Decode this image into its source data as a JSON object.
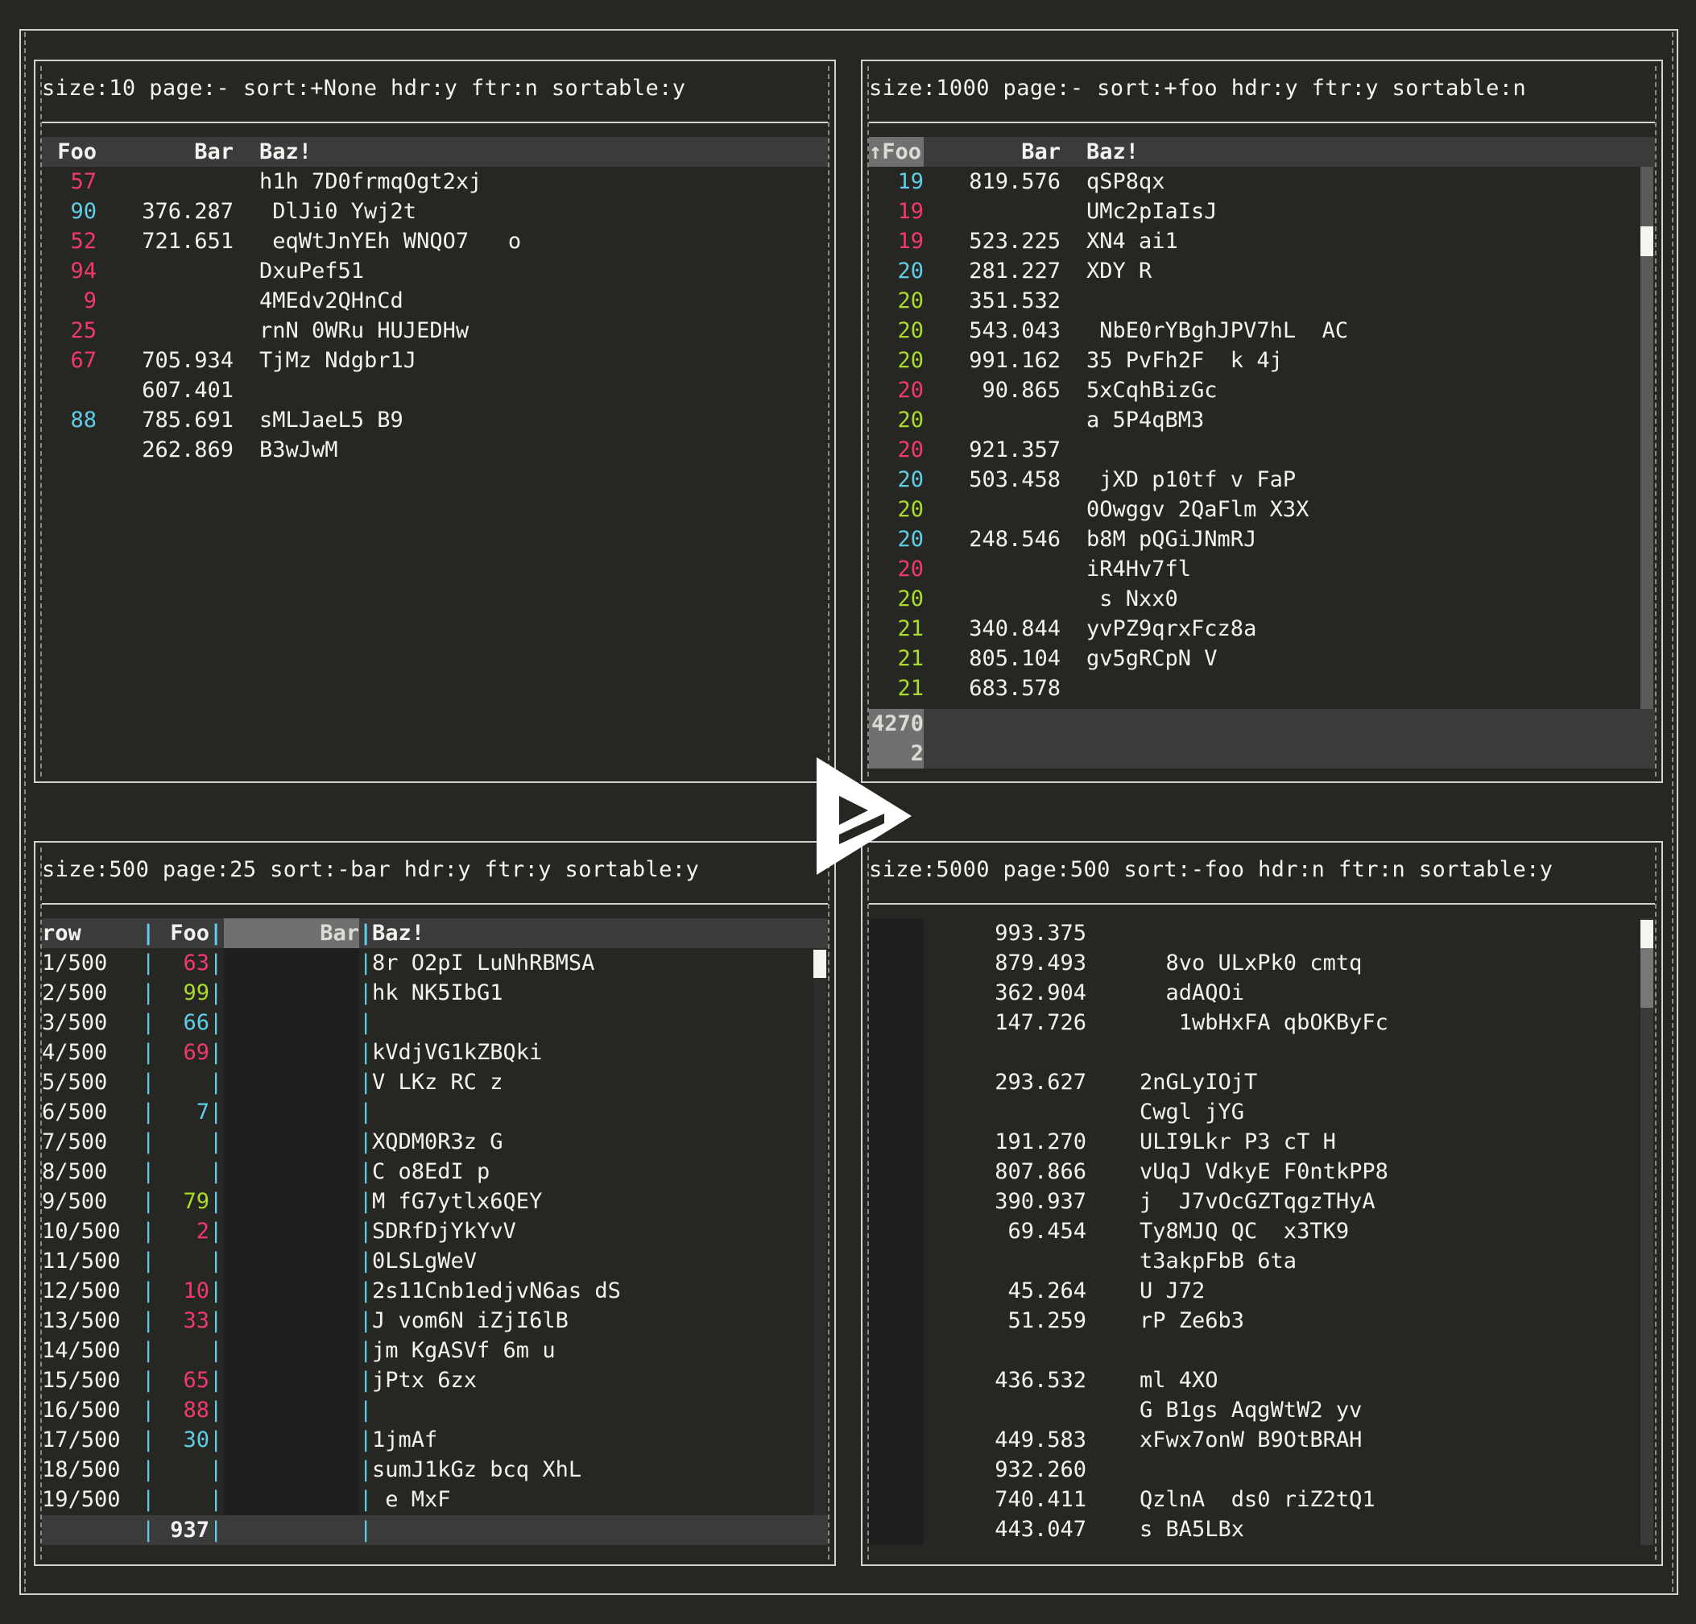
{
  "panels": {
    "p1": {
      "title": "size:10 page:- sort:+None hdr:y ftr:n sortable:y",
      "headers": {
        "foo": "Foo",
        "bar": "Bar",
        "baz": "Baz!"
      },
      "rows": [
        {
          "foo": "57",
          "foo_color": "red",
          "bar": "",
          "baz": "h1h 7D0frmqOgt2xj"
        },
        {
          "foo": "90",
          "foo_color": "cyan",
          "bar": "376.287",
          "baz": " DlJi0 Ywj2t"
        },
        {
          "foo": "52",
          "foo_color": "red",
          "bar": "721.651",
          "baz": " eqWtJnYEh WNQO7   o"
        },
        {
          "foo": "94",
          "foo_color": "red",
          "bar": "",
          "baz": "DxuPef51"
        },
        {
          "foo": "9",
          "foo_color": "red",
          "bar": "",
          "baz": "4MEdv2QHnCd"
        },
        {
          "foo": "25",
          "foo_color": "red",
          "bar": "",
          "baz": "rnN 0WRu HUJEDHw"
        },
        {
          "foo": "67",
          "foo_color": "red",
          "bar": "705.934",
          "baz": "TjMz Ndgbr1J"
        },
        {
          "foo": "",
          "foo_color": "red",
          "bar": "607.401",
          "baz": ""
        },
        {
          "foo": "88",
          "foo_color": "cyan",
          "bar": "785.691",
          "baz": "sMLJaeL5 B9"
        },
        {
          "foo": "",
          "foo_color": "red",
          "bar": "262.869",
          "baz": "B3wJwM"
        }
      ]
    },
    "p2": {
      "title": "size:1000 page:- sort:+foo hdr:y ftr:y sortable:n",
      "headers": {
        "foo": "↑Foo",
        "bar": "Bar",
        "baz": "Baz!"
      },
      "rows": [
        {
          "foo": "19",
          "foo_color": "cyan",
          "bar": "819.576",
          "baz": "qSP8qx"
        },
        {
          "foo": "19",
          "foo_color": "red",
          "bar": "",
          "baz": "UMc2pIaIsJ"
        },
        {
          "foo": "19",
          "foo_color": "red",
          "bar": "523.225",
          "baz": "XN4 ai1"
        },
        {
          "foo": "20",
          "foo_color": "cyan",
          "bar": "281.227",
          "baz": "XDY R"
        },
        {
          "foo": "20",
          "foo_color": "green",
          "bar": "351.532",
          "baz": ""
        },
        {
          "foo": "20",
          "foo_color": "green",
          "bar": "543.043",
          "baz": " NbE0rYBghJPV7hL  AC"
        },
        {
          "foo": "20",
          "foo_color": "green",
          "bar": "991.162",
          "baz": "35 PvFh2F  k 4j"
        },
        {
          "foo": "20",
          "foo_color": "red",
          "bar": "90.865",
          "baz": "5xCqhBizGc"
        },
        {
          "foo": "20",
          "foo_color": "green",
          "bar": "",
          "baz": "a 5P4qBM3"
        },
        {
          "foo": "20",
          "foo_color": "red",
          "bar": "921.357",
          "baz": ""
        },
        {
          "foo": "20",
          "foo_color": "cyan",
          "bar": "503.458",
          "baz": " jXD p10tf v FaP"
        },
        {
          "foo": "20",
          "foo_color": "green",
          "bar": "",
          "baz": "0Owggv 2QaFlm X3X"
        },
        {
          "foo": "20",
          "foo_color": "cyan",
          "bar": "248.546",
          "baz": "b8M pQGiJNmRJ"
        },
        {
          "foo": "20",
          "foo_color": "red",
          "bar": "",
          "baz": "iR4Hv7fl"
        },
        {
          "foo": "20",
          "foo_color": "green",
          "bar": "",
          "baz": " s Nxx0"
        },
        {
          "foo": "21",
          "foo_color": "green",
          "bar": "340.844",
          "baz": "yvPZ9qrxFcz8a"
        },
        {
          "foo": "21",
          "foo_color": "green",
          "bar": "805.104",
          "baz": "gv5gRCpN V"
        },
        {
          "foo": "21",
          "foo_color": "green",
          "bar": "683.578",
          "baz": ""
        }
      ],
      "footer": {
        "line1": "4270",
        "line2": "2"
      }
    },
    "p3": {
      "title": "size:500 page:25 sort:-bar hdr:y ftr:y sortable:y",
      "headers": {
        "row": "row",
        "foo": "Foo",
        "bar": "Bar",
        "baz": "Baz!"
      },
      "rows": [
        {
          "row": "1/500",
          "foo": "63",
          "foo_color": "red",
          "baz": "8r O2pI LuNhRBMSA"
        },
        {
          "row": "2/500",
          "foo": "99",
          "foo_color": "green",
          "baz": "hk NK5IbG1"
        },
        {
          "row": "3/500",
          "foo": "66",
          "foo_color": "cyan",
          "baz": ""
        },
        {
          "row": "4/500",
          "foo": "69",
          "foo_color": "red",
          "baz": "kVdjVG1kZBQki"
        },
        {
          "row": "5/500",
          "foo": "",
          "foo_color": "red",
          "baz": "V LKz RC z"
        },
        {
          "row": "6/500",
          "foo": "7",
          "foo_color": "cyan",
          "baz": ""
        },
        {
          "row": "7/500",
          "foo": "",
          "foo_color": "red",
          "baz": "XQDM0R3z G"
        },
        {
          "row": "8/500",
          "foo": "",
          "foo_color": "red",
          "baz": "C o8EdI p"
        },
        {
          "row": "9/500",
          "foo": "79",
          "foo_color": "green",
          "baz": "M fG7ytlx6QEY"
        },
        {
          "row": "10/500",
          "foo": "2",
          "foo_color": "red",
          "baz": "SDRfDjYkYvV"
        },
        {
          "row": "11/500",
          "foo": "",
          "foo_color": "red",
          "baz": "0LSLgWeV"
        },
        {
          "row": "12/500",
          "foo": "10",
          "foo_color": "red",
          "baz": "2s11Cnb1edjvN6as dS"
        },
        {
          "row": "13/500",
          "foo": "33",
          "foo_color": "red",
          "baz": "J vom6N iZjI6lB"
        },
        {
          "row": "14/500",
          "foo": "",
          "foo_color": "red",
          "baz": "jm KgASVf 6m u"
        },
        {
          "row": "15/500",
          "foo": "65",
          "foo_color": "red",
          "baz": "jPtx 6zx"
        },
        {
          "row": "16/500",
          "foo": "88",
          "foo_color": "red",
          "baz": ""
        },
        {
          "row": "17/500",
          "foo": "30",
          "foo_color": "cyan",
          "baz": "1jmAf"
        },
        {
          "row": "18/500",
          "foo": "",
          "foo_color": "red",
          "baz": "sumJ1kGz bcq XhL"
        },
        {
          "row": "19/500",
          "foo": "",
          "foo_color": "red",
          "baz": " e MxF"
        }
      ],
      "footer": {
        "foo": "937"
      }
    },
    "p4": {
      "title": "size:5000 page:500 sort:-foo hdr:n ftr:n sortable:y",
      "rows": [
        {
          "bar": "993.375",
          "baz": ""
        },
        {
          "bar": "879.493",
          "baz": "  8vo ULxPk0 cmtq"
        },
        {
          "bar": "362.904",
          "baz": "  adAQOi"
        },
        {
          "bar": "147.726",
          "baz": "   1wbHxFA qbOKByFc"
        },
        {
          "bar": "",
          "baz": ""
        },
        {
          "bar": "293.627",
          "baz": "2nGLyIOjT"
        },
        {
          "bar": "",
          "baz": "Cwgl jYG"
        },
        {
          "bar": "191.270",
          "baz": "ULI9Lkr P3 cT H"
        },
        {
          "bar": "807.866",
          "baz": "vUqJ VdkyE F0ntkPP8"
        },
        {
          "bar": "390.937",
          "baz": "j  J7vOcGZTqgzTHyA"
        },
        {
          "bar": "69.454",
          "baz": "Ty8MJQ QC  x3TK9"
        },
        {
          "bar": "",
          "baz": "t3akpFbB 6ta"
        },
        {
          "bar": "45.264",
          "baz": "U J72"
        },
        {
          "bar": "51.259",
          "baz": "rP Ze6b3"
        },
        {
          "bar": "",
          "baz": ""
        },
        {
          "bar": "436.532",
          "baz": "ml 4XO"
        },
        {
          "bar": "",
          "baz": "G B1gs AqgWtW2 yv"
        },
        {
          "bar": "449.583",
          "baz": "xFwx7onW B9OtBRAH"
        },
        {
          "bar": "932.260",
          "baz": ""
        },
        {
          "bar": "740.411",
          "baz": "QzlnA  ds0 riZ2tQ1"
        },
        {
          "bar": "443.047",
          "baz": "s BA5LBx"
        }
      ]
    }
  },
  "colors": {
    "red": "#f23a6a",
    "cyan": "#60cde8",
    "green": "#a9dc2c"
  },
  "logo_icon": "play-triangle-logo"
}
